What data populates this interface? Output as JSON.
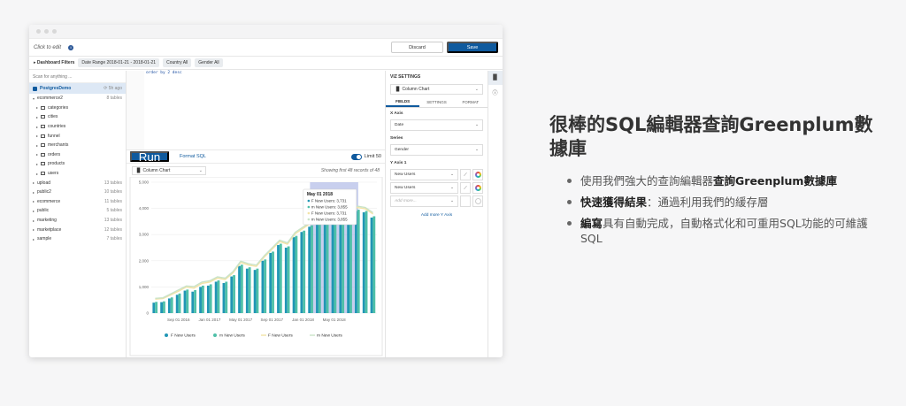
{
  "toolbar": {
    "click_to_edit": "Click to edit",
    "discard": "Discard",
    "save": "Save"
  },
  "filters": {
    "label": "Dashboard Filters",
    "chips": [
      "Date Range 2018-01-21 - 2018-01-21",
      "Country All",
      "Gender All"
    ]
  },
  "sidebar": {
    "search_placeholder": "Scan for anything ...",
    "db_name": "PostgresDemo",
    "db_ago": "5h ago",
    "schemas": [
      {
        "name": "ecommerce2",
        "count": "8 tables",
        "open": true,
        "tables": [
          "categories",
          "cities",
          "countries",
          "funnel",
          "merchants",
          "orders",
          "products",
          "users"
        ]
      },
      {
        "name": "upload",
        "count": "13 tables"
      },
      {
        "name": "public2",
        "count": "10 tables"
      },
      {
        "name": "ecommerce",
        "count": "11 tables"
      },
      {
        "name": "public",
        "count": "5 tables"
      },
      {
        "name": "marketing",
        "count": "13 tables"
      },
      {
        "name": "marketplace",
        "count": "12 tables"
      },
      {
        "name": "sample",
        "count": "7 tables"
      }
    ]
  },
  "editor": {
    "code_line": "order by 2 desc"
  },
  "runbar": {
    "run": "Run",
    "format": "Format SQL",
    "limit": "Limit 50"
  },
  "chartpanel": {
    "type_label": "Column Chart",
    "showing": "Showing first 48 records of 48"
  },
  "viz": {
    "title": "VIZ SETTINGS",
    "chart_type": "Column Chart",
    "tabs": [
      "FIELDS",
      "SETTINGS",
      "FORMAT"
    ],
    "x_axis_label": "X Axis",
    "x_axis_value": "Date",
    "series_label": "Series",
    "series_value": "Gender",
    "y_axis_label": "Y Axis 1",
    "y_fields": [
      "New Users",
      "New Users"
    ],
    "add_placeholder": "Add more...",
    "add_more": "Add more Y Axis"
  },
  "promo": {
    "title": "很棒的SQL編輯器查詢Greenplum數據庫",
    "bullets": [
      {
        "pre": "使用我們強大的查詢編輯器",
        "bold": "查詢Greenplum數據庫",
        "post": ""
      },
      {
        "pre": "",
        "bold": "快速獲得結果",
        "post": "：通過利用我們的緩存層"
      },
      {
        "pre": "",
        "bold": "編寫",
        "post": "具有自動完成，自動格式化和可重用SQL功能的可維護SQL"
      }
    ]
  },
  "colors": {
    "accent": "#0f5a9e",
    "f_bar": "#2196b5",
    "m_bar": "#4fc0a8",
    "f_line": "#f3e3a6",
    "m_line": "#c9e3c8",
    "highlight": "#9aa7e0"
  },
  "chart_data": {
    "type": "bar",
    "x": [
      "2016-06",
      "2016-07",
      "2016-08",
      "2016-09",
      "2016-10",
      "2016-11",
      "2016-12",
      "2017-01",
      "2017-02",
      "2017-03",
      "2017-04",
      "2017-05",
      "2017-06",
      "2017-07",
      "2017-08",
      "2017-09",
      "2017-10",
      "2017-11",
      "2017-12",
      "2018-01",
      "2018-02",
      "2018-03",
      "2018-04",
      "2018-05",
      "2018-06",
      "2018-07",
      "2018-08",
      "2018-09",
      "2018-10"
    ],
    "x_ticks": [
      "Sep 01 2016",
      "Jan 01 2017",
      "May 01 2017",
      "Sep 01 2017",
      "Jan 01 2018",
      "May 01 2018"
    ],
    "y_ticks": [
      "0",
      "1,000",
      "2,000",
      "3,000",
      "4,000",
      "5,000"
    ],
    "ylim": [
      0,
      5000
    ],
    "series": [
      {
        "name": "F New Users",
        "kind": "bar",
        "values": [
          400,
          420,
          560,
          700,
          860,
          820,
          1000,
          1050,
          1200,
          1150,
          1400,
          1800,
          1700,
          1650,
          2000,
          2300,
          2600,
          2500,
          2900,
          3100,
          3300,
          3500,
          3650,
          3731,
          3600,
          3800,
          3900,
          3850,
          3650
        ]
      },
      {
        "name": "m New Users",
        "kind": "bar",
        "values": [
          430,
          450,
          600,
          750,
          900,
          880,
          1050,
          1100,
          1250,
          1200,
          1450,
          1850,
          1750,
          1700,
          2050,
          2350,
          2650,
          2550,
          2950,
          3150,
          3350,
          3550,
          3700,
          3855,
          3650,
          3850,
          3950,
          3900,
          3700
        ]
      },
      {
        "name": "F New Users",
        "kind": "line",
        "values": [
          400,
          420,
          560,
          700,
          860,
          820,
          1000,
          1050,
          1200,
          1150,
          1400,
          1800,
          1700,
          1650,
          2000,
          2300,
          2600,
          2500,
          2900,
          3100,
          3300,
          3500,
          3650,
          3731,
          3600,
          3800,
          3900,
          3850,
          3650
        ]
      },
      {
        "name": "m New Users",
        "kind": "line",
        "values": [
          430,
          450,
          600,
          750,
          900,
          880,
          1050,
          1100,
          1250,
          1200,
          1450,
          1850,
          1750,
          1700,
          2050,
          2350,
          2650,
          2550,
          2950,
          3150,
          3350,
          3550,
          3700,
          3855,
          3650,
          3850,
          3950,
          3900,
          3700
        ]
      }
    ],
    "highlight_index": 23,
    "tooltip": {
      "title": "May 01 2018",
      "lines": [
        "F New Users: 3,731",
        "m New Users: 3,855",
        "F New Users: 3,731",
        "m New Users: 3,855"
      ]
    },
    "legend": [
      "F New Users",
      "m New Users",
      "F New Users",
      "m New Users"
    ]
  }
}
